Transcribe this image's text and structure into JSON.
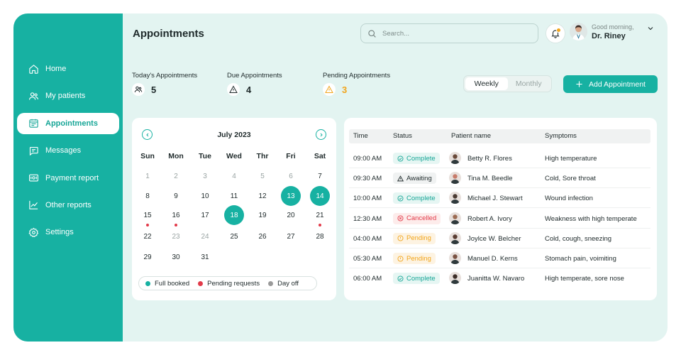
{
  "sidebar": {
    "items": [
      {
        "label": "Home",
        "icon": "home-icon"
      },
      {
        "label": "My patients",
        "icon": "users-icon"
      },
      {
        "label": "Appointments",
        "icon": "calendar-list-icon",
        "active": true
      },
      {
        "label": "Messages",
        "icon": "message-icon"
      },
      {
        "label": "Payment report",
        "icon": "payment-icon"
      },
      {
        "label": "Other reports",
        "icon": "chart-line-icon"
      },
      {
        "label": "Settings",
        "icon": "gear-icon"
      }
    ]
  },
  "header": {
    "title": "Appointments",
    "search_placeholder": "Search...",
    "greeting": "Good morning,",
    "user_name": "Dr. Riney"
  },
  "stats": [
    {
      "label": "Today's Appointments",
      "value": "5",
      "icon": "users-icon"
    },
    {
      "label": "Due Appointments",
      "value": "4",
      "icon": "warning-icon"
    },
    {
      "label": "Pending Appointments",
      "value": "3",
      "icon": "warning-icon"
    }
  ],
  "view_toggle": {
    "options": [
      "Weekly",
      "Monthly"
    ],
    "selected": "Weekly"
  },
  "add_button": "Add Appointment",
  "calendar": {
    "month": "July 2023",
    "weekdays": [
      "Sun",
      "Mon",
      "Tue",
      "Wed",
      "Thr",
      "Fri",
      "Sat"
    ],
    "weeks": [
      [
        "1",
        "2",
        "3",
        "4",
        "5",
        "6",
        "7"
      ],
      [
        "8",
        "9",
        "10",
        "11",
        "12",
        "13",
        "14"
      ],
      [
        "15",
        "16",
        "17",
        "18",
        "19",
        "20",
        "21"
      ],
      [
        "22",
        "23",
        "24",
        "25",
        "26",
        "27",
        "28"
      ],
      [
        "29",
        "30",
        "31",
        "",
        "",
        "",
        "",
        ""
      ]
    ],
    "legend": [
      {
        "label": "Full booked",
        "color": "#17b1a2"
      },
      {
        "label": "Pending requests",
        "color": "#e23b4a"
      },
      {
        "label": "Day off",
        "color": "#9a9a9a"
      }
    ]
  },
  "table": {
    "columns": [
      "Time",
      "Status",
      "Patient name",
      "Symptoms"
    ],
    "rows": [
      {
        "time": "09:00 AM",
        "status": "Complete",
        "patient": "Betty R. Flores",
        "symptoms": "High temperature"
      },
      {
        "time": "09:30 AM",
        "status": "Awaiting",
        "patient": "Tina M. Beedle",
        "symptoms": "Cold, Sore throat"
      },
      {
        "time": "10:00 AM",
        "status": "Complete",
        "patient": "Michael J. Stewart",
        "symptoms": "Wound infection"
      },
      {
        "time": "12:30 AM",
        "status": "Cancelled",
        "patient": "Robert A. Ivory",
        "symptoms": "Weakness with high temperate"
      },
      {
        "time": "04:00 AM",
        "status": "Pending",
        "patient": "Joylce W. Belcher",
        "symptoms": "Cold, cough, sneezing"
      },
      {
        "time": "05:30 AM",
        "status": "Pending",
        "patient": "Manuel D. Kerns",
        "symptoms": "Stomach pain, voimiting"
      },
      {
        "time": "06:00 AM",
        "status": "Complete",
        "patient": "Juanitta W. Navaro",
        "symptoms": "High temperate, sore nose"
      }
    ]
  },
  "status_colors": {
    "Complete": {
      "fg": "#17a697",
      "bg": "#e6f6f3"
    },
    "Awaiting": {
      "fg": "#1f2a2b",
      "bg": "#f0f2f2"
    },
    "Cancelled": {
      "fg": "#e23b4a",
      "bg": "#fdeceb"
    },
    "Pending": {
      "fg": "#f1a51c",
      "bg": "#fdf3e2"
    }
  }
}
